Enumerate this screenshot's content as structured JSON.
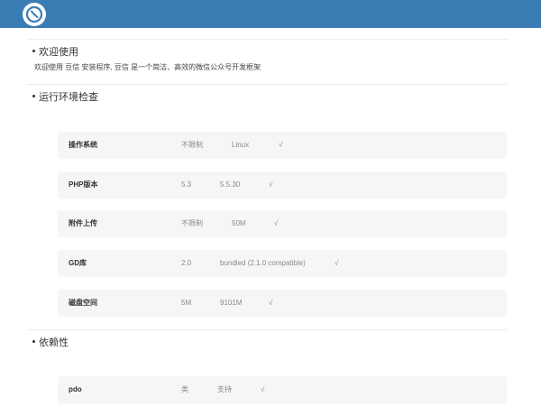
{
  "header": {
    "logo_icon": "compass-logo-icon",
    "background_color": "#3a7db4"
  },
  "welcome": {
    "title": "欢迎使用",
    "description": "欢迎使用 豆信 安装程序, 豆信 是一个简洁、高效的微信公众号开发框架"
  },
  "env_check": {
    "title": "运行环境检查",
    "rows": [
      {
        "name": "操作系统",
        "required": "不限制",
        "current": "Linux",
        "status": "√"
      },
      {
        "name": "PHP版本",
        "required": "5.3",
        "current": "5.5.30",
        "status": "√"
      },
      {
        "name": "附件上传",
        "required": "不限制",
        "current": "50M",
        "status": "√"
      },
      {
        "name": "GD库",
        "required": "2.0",
        "current": "bundled (2.1.0 compatible)",
        "status": "√"
      },
      {
        "name": "磁盘空间",
        "required": "5M",
        "current": "9101M",
        "status": "√"
      }
    ]
  },
  "dependency": {
    "title": "依赖性",
    "rows": [
      {
        "name": "pdo",
        "type": "类",
        "support": "支持",
        "status": "√"
      }
    ]
  }
}
